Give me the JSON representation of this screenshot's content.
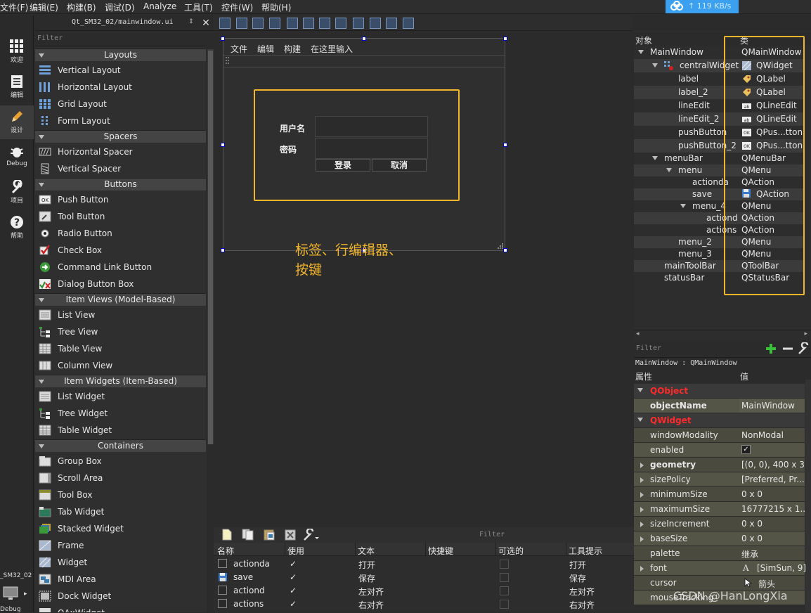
{
  "menubar": [
    "文件(F)",
    "编辑(E)",
    "构建(B)",
    "调试(D)",
    "Analyze",
    "工具(T)",
    "控件(W)",
    "帮助(H)"
  ],
  "speed": "119 KB/s",
  "modes": [
    "欢迎",
    "编辑",
    "设计",
    "Debug",
    "项目",
    "帮助"
  ],
  "bottom_project": "_SM32_02",
  "bottom_debug": "Debug",
  "file": {
    "name": "Qt_SM32_02/mainwindow.ui",
    "updown": "⇕",
    "close": "✕"
  },
  "widgetbox": {
    "filter": "Filter",
    "categories": {
      "layouts": "Layouts",
      "spacers": "Spacers",
      "buttons": "Buttons",
      "itemviews": "Item Views (Model-Based)",
      "itemwidgets": "Item Widgets (Item-Based)",
      "containers": "Containers"
    },
    "items": [
      "Vertical Layout",
      "Horizontal Layout",
      "Grid Layout",
      "Form Layout",
      "Horizontal Spacer",
      "Vertical Spacer",
      "Push Button",
      "Tool Button",
      "Radio Button",
      "Check Box",
      "Command Link Button",
      "Dialog Button Box",
      "List View",
      "Tree View",
      "Table View",
      "Column View",
      "List Widget",
      "Tree Widget",
      "Table Widget",
      "Group Box",
      "Scroll Area",
      "Tool Box",
      "Tab Widget",
      "Stacked Widget",
      "Frame",
      "Widget",
      "MDI Area",
      "Dock Widget",
      "QAxWidget"
    ]
  },
  "form": {
    "menus": [
      "文件",
      "编辑",
      "构建",
      "在这里输入"
    ],
    "label_user": "用户名",
    "label_pass": "密码",
    "btn_login": "登录",
    "btn_cancel": "取消"
  },
  "annotation": "标签、行编辑器、按键",
  "action_editor": {
    "filter": "Filter",
    "headers": [
      "名称",
      "使用",
      "文本",
      "快捷键",
      "可选的",
      "工具提示"
    ],
    "rows": [
      {
        "name": "actionda",
        "used": "✓",
        "text": "打开",
        "tip": "打开"
      },
      {
        "name": "save",
        "used": "✓",
        "text": "保存",
        "tip": "保存"
      },
      {
        "name": "actiond",
        "used": "✓",
        "text": "左对齐",
        "tip": "左对齐"
      },
      {
        "name": "actions",
        "used": "✓",
        "text": "右对齐",
        "tip": "右对齐"
      }
    ]
  },
  "object_inspector": {
    "headers": [
      "对象",
      "类"
    ],
    "rows": [
      {
        "name": "MainWindow",
        "cls": "QMainWindow"
      },
      {
        "name": "centralWidget",
        "cls": "QWidget"
      },
      {
        "name": "label",
        "cls": "QLabel"
      },
      {
        "name": "label_2",
        "cls": "QLabel"
      },
      {
        "name": "lineEdit",
        "cls": "QLineEdit"
      },
      {
        "name": "lineEdit_2",
        "cls": "QLineEdit"
      },
      {
        "name": "pushButton",
        "cls": "QPus...tton"
      },
      {
        "name": "pushButton_2",
        "cls": "QPus...tton"
      },
      {
        "name": "menuBar",
        "cls": "QMenuBar"
      },
      {
        "name": "menu",
        "cls": "QMenu"
      },
      {
        "name": "actionda",
        "cls": "QAction"
      },
      {
        "name": "save",
        "cls": "QAction"
      },
      {
        "name": "menu_4",
        "cls": "QMenu"
      },
      {
        "name": "actiond",
        "cls": "QAction"
      },
      {
        "name": "actions",
        "cls": "QAction"
      },
      {
        "name": "menu_2",
        "cls": "QMenu"
      },
      {
        "name": "menu_3",
        "cls": "QMenu"
      },
      {
        "name": "mainToolBar",
        "cls": "QToolBar"
      },
      {
        "name": "statusBar",
        "cls": "QStatusBar"
      }
    ]
  },
  "property_editor": {
    "filter": "Filter",
    "object": "MainWindow : QMainWindow",
    "headers": [
      "属性",
      "值"
    ],
    "rows": [
      {
        "name": "QObject",
        "value": ""
      },
      {
        "name": "objectName",
        "value": "MainWindow"
      },
      {
        "name": "QWidget",
        "value": ""
      },
      {
        "name": "windowModality",
        "value": "NonModal"
      },
      {
        "name": "enabled",
        "value": "✓"
      },
      {
        "name": "geometry",
        "value": "[(0, 0), 400 x 3..."
      },
      {
        "name": "sizePolicy",
        "value": "[Preferred, Pr..."
      },
      {
        "name": "minimumSize",
        "value": "0 x 0"
      },
      {
        "name": "maximumSize",
        "value": "16777215 x 1..."
      },
      {
        "name": "sizeIncrement",
        "value": "0 x 0"
      },
      {
        "name": "baseSize",
        "value": "0 x 0"
      },
      {
        "name": "palette",
        "value": "继承"
      },
      {
        "name": "font",
        "value": "[SimSun, 9]"
      },
      {
        "name": "cursor",
        "value": "箭头"
      },
      {
        "name": "mouseTracking",
        "value": ""
      }
    ]
  },
  "watermark": "CSDN @HanLongXia",
  "colors": {
    "highlight": "#f2b52c",
    "class_header": "#ff2a2a",
    "speed_badge": "#3aa0ef"
  }
}
